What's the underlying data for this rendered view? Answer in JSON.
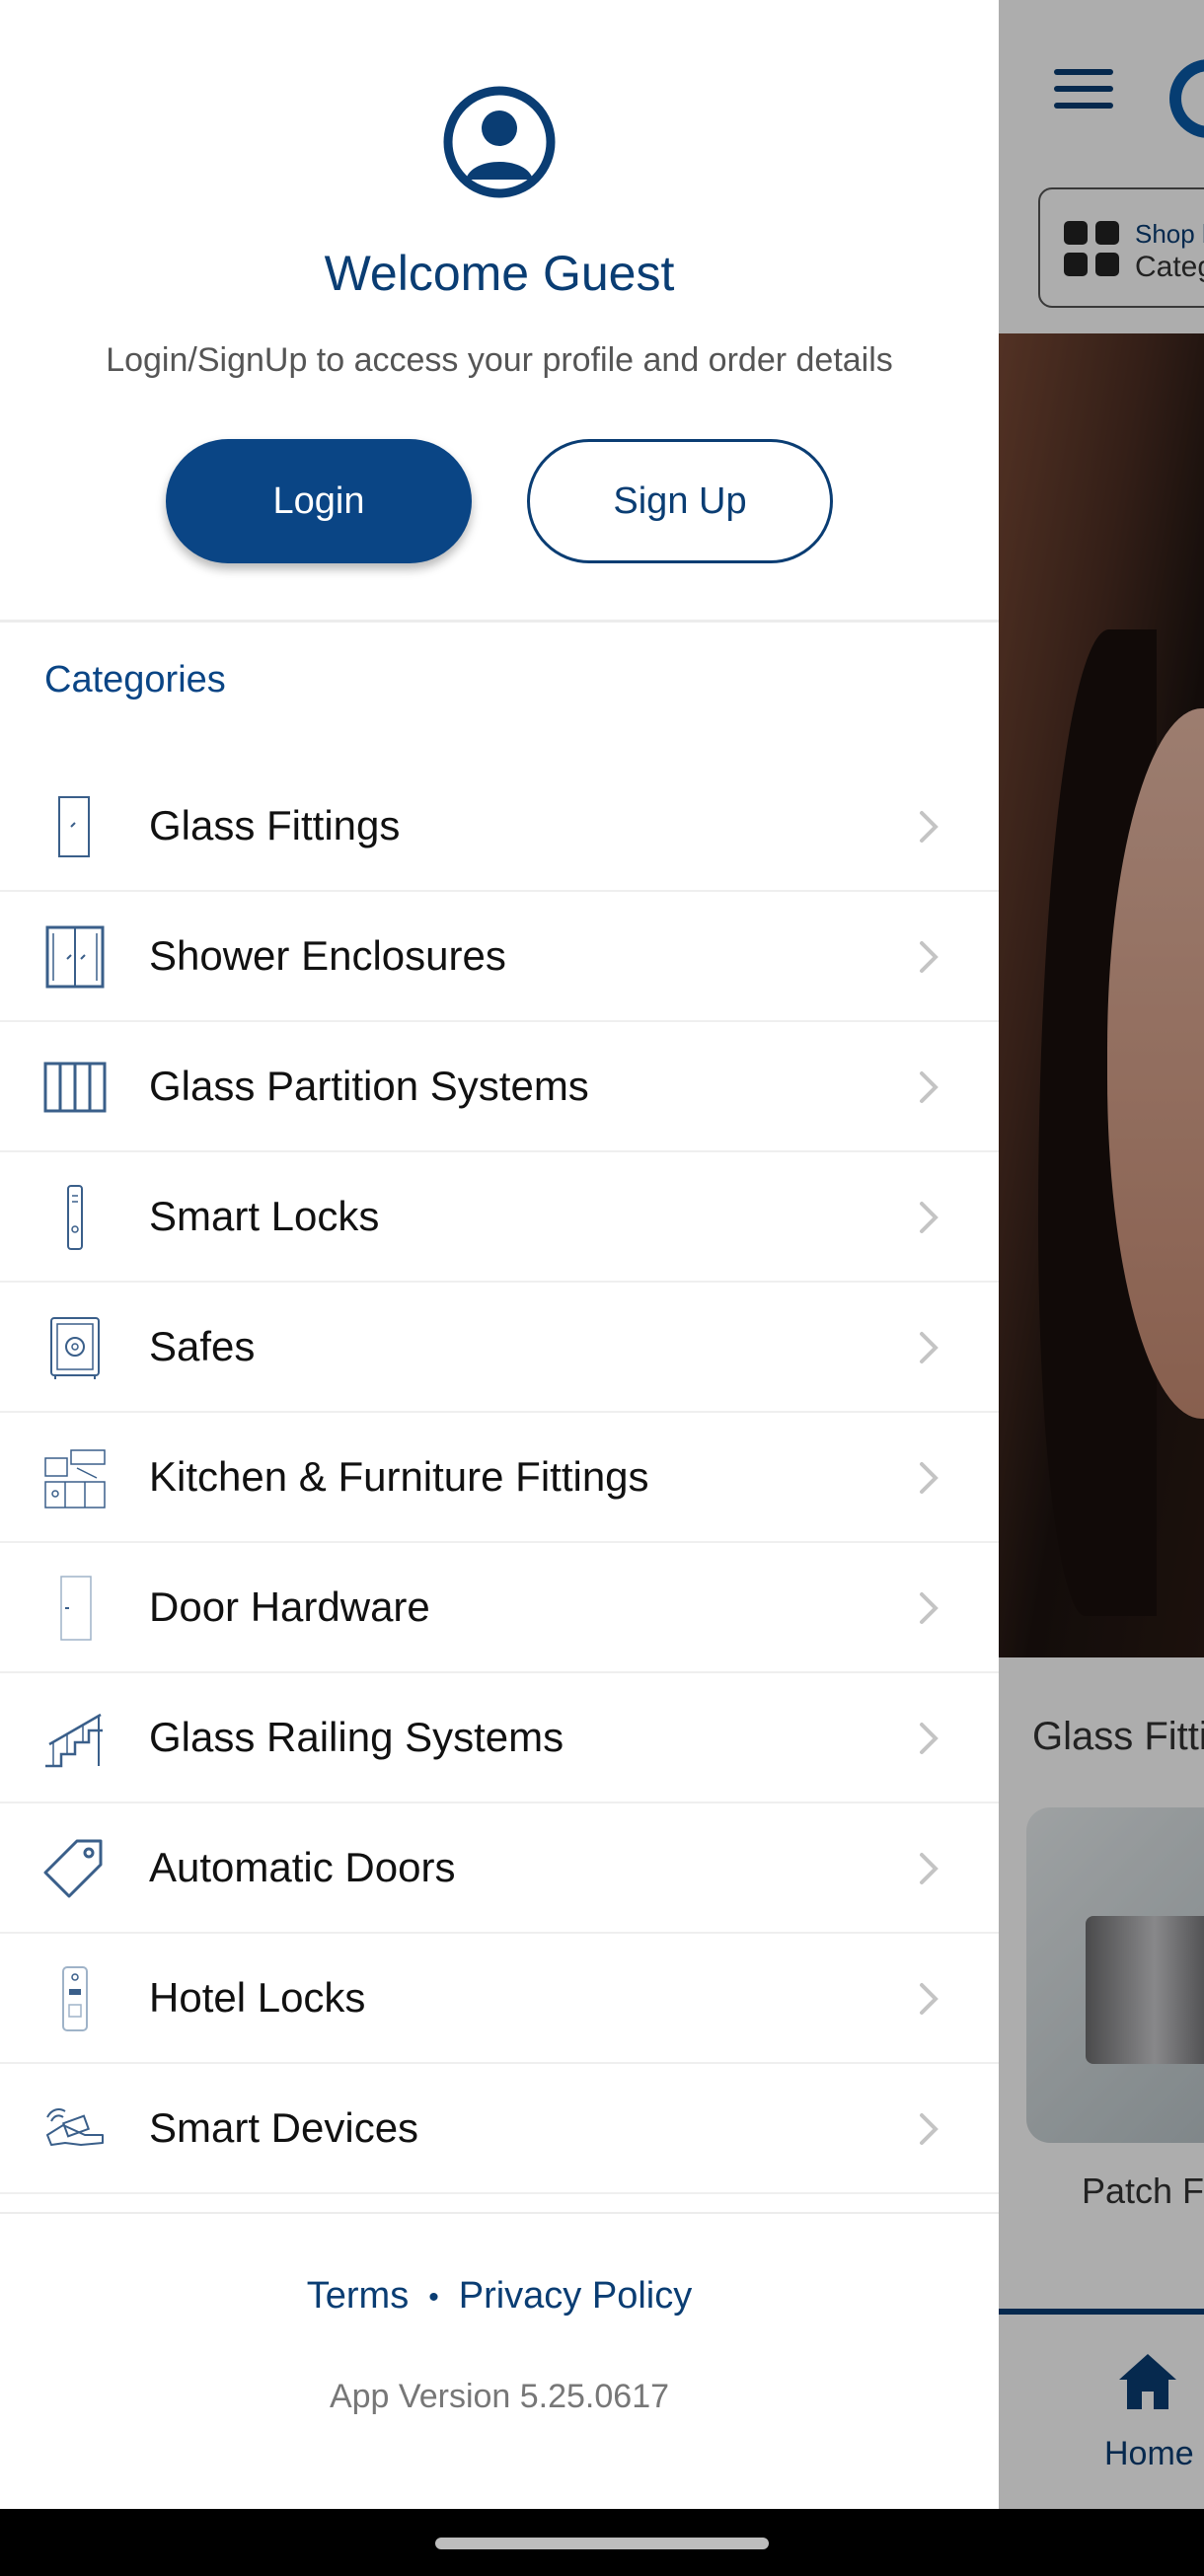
{
  "drawer": {
    "welcome_title": "Welcome Guest",
    "subtitle": "Login/SignUp to access your profile and order details",
    "login_label": "Login",
    "signup_label": "Sign Up",
    "categories_heading": "Categories",
    "categories": [
      {
        "label": "Glass Fittings",
        "icon": "glass-door-icon"
      },
      {
        "label": "Shower Enclosures",
        "icon": "shower-enclosure-icon"
      },
      {
        "label": "Glass Partition Systems",
        "icon": "partition-icon"
      },
      {
        "label": "Smart Locks",
        "icon": "smart-lock-icon"
      },
      {
        "label": "Safes",
        "icon": "safe-icon"
      },
      {
        "label": "Kitchen & Furniture Fittings",
        "icon": "kitchen-icon"
      },
      {
        "label": "Door Hardware",
        "icon": "door-icon"
      },
      {
        "label": "Glass Railing Systems",
        "icon": "railing-icon"
      },
      {
        "label": "Automatic Doors",
        "icon": "tag-icon"
      },
      {
        "label": "Hotel Locks",
        "icon": "hotel-lock-icon"
      },
      {
        "label": "Smart Devices",
        "icon": "smart-card-icon"
      }
    ],
    "terms_label": "Terms",
    "separator": "•",
    "privacy_label": "Privacy Policy",
    "app_version": "App Version 5.25.0617"
  },
  "background": {
    "shop_by_label": "Shop by",
    "category_label": "Category",
    "section_title": "Glass Fittings",
    "card_label": "Patch Fittings",
    "home_tab_label": "Home"
  },
  "colors": {
    "brand_navy": "#0a3d73",
    "button_fill": "#0a4585"
  }
}
